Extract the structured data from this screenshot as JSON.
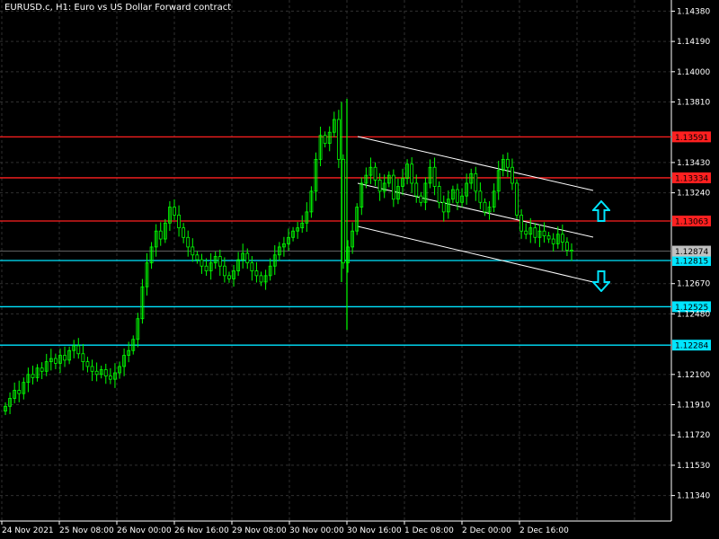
{
  "window": {
    "title": "EURUSD.c, H1:  Euro vs US Dollar Forward contract"
  },
  "price_axis": {
    "ticks": [
      "1.14380",
      "1.14190",
      "1.14000",
      "1.13810",
      "1.13430",
      "1.13240",
      "1.12670",
      "1.12480",
      "1.12100",
      "1.11910",
      "1.11720",
      "1.11530",
      "1.11340"
    ],
    "range": [
      1.1118,
      1.1445
    ]
  },
  "time_axis": {
    "labels": [
      "24 Nov 2021",
      "25 Nov 08:00",
      "26 Nov 00:00",
      "26 Nov 16:00",
      "29 Nov 08:00",
      "30 Nov 00:00",
      "30 Nov 16:00",
      "1 Dec 08:00",
      "2 Dec 00:00",
      "2 Dec 16:00"
    ]
  },
  "horizontal_lines": [
    {
      "price": 1.13591,
      "label": "1.13591",
      "color": "#ff2020",
      "label_bg": "#ff2020",
      "label_fg": "#000000"
    },
    {
      "price": 1.13334,
      "label": "1.13334",
      "color": "#ff2020",
      "label_bg": "#ff2020",
      "label_fg": "#000000"
    },
    {
      "price": 1.13063,
      "label": "1.13063",
      "color": "#ff2020",
      "label_bg": "#ff2020",
      "label_fg": "#000000"
    },
    {
      "price": 1.12815,
      "label": "1.12815",
      "color": "#00e5ff",
      "label_bg": "#00e5ff",
      "label_fg": "#000000"
    },
    {
      "price": 1.12525,
      "label": "1.12525",
      "color": "#00e5ff",
      "label_bg": "#00e5ff",
      "label_fg": "#000000"
    },
    {
      "price": 1.12284,
      "label": "1.12284",
      "color": "#00e5ff",
      "label_bg": "#00e5ff",
      "label_fg": "#000000"
    }
  ],
  "current_price": {
    "label": "1.12874",
    "bg": "#c0c0c0",
    "fg": "#000000"
  },
  "colors": {
    "candle": "#00ff00",
    "grid": "#303030",
    "channel": "#ffffff",
    "arrow": "#00e5ff"
  },
  "chart_data": {
    "type": "candlestick",
    "symbol": "EURUSD.c",
    "timeframe": "H1",
    "ylim": [
      1.1118,
      1.1445
    ],
    "xlabels": [
      "24 Nov 2021",
      "25 Nov 08:00",
      "26 Nov 00:00",
      "26 Nov 16:00",
      "29 Nov 08:00",
      "30 Nov 00:00",
      "30 Nov 16:00",
      "1 Dec 08:00",
      "2 Dec 00:00",
      "2 Dec 16:00"
    ],
    "close_path": [
      [
        1.119,
        1.1195,
        1.12,
        1.1198,
        1.1205,
        1.121,
        1.1208,
        1.1214,
        1.1212,
        1.1218,
        1.122,
        1.1217,
        1.1222,
        1.1219,
        1.1225,
        1.1228,
        1.1223,
        1.1218,
        1.1215,
        1.1212,
        1.121,
        1.1213,
        1.1209,
        1.1207,
        1.1211,
        1.1215,
        1.1222,
        1.1225,
        1.1232,
        1.1245,
        1.1265,
        1.128,
        1.129,
        1.13,
        1.1295,
        1.1305,
        1.1315,
        1.131,
        1.1302,
        1.1296,
        1.129,
        1.1285,
        1.1282,
        1.1278,
        1.1275,
        1.128,
        1.1284,
        1.1278,
        1.1272,
        1.127,
        1.1275,
        1.1282,
        1.1286,
        1.128,
        1.1275,
        1.1272,
        1.1268,
        1.1272,
        1.1278,
        1.1285,
        1.129,
        1.1292,
        1.1296,
        1.13,
        1.1302,
        1.1305,
        1.1312,
        1.1325,
        1.1345,
        1.136,
        1.1355,
        1.1362,
        1.137,
        1.1345,
        1.128,
        1.129,
        1.13,
        1.1315,
        1.133,
        1.1335,
        1.134,
        1.1332,
        1.1325,
        1.133,
        1.1335,
        1.132,
        1.1328,
        1.1333,
        1.1342,
        1.133,
        1.1322,
        1.1318,
        1.133,
        1.134,
        1.1328,
        1.1318,
        1.1312,
        1.132,
        1.1326,
        1.1318,
        1.1322,
        1.133,
        1.1336,
        1.1325,
        1.1318,
        1.1312,
        1.1315,
        1.1325,
        1.1338,
        1.1345,
        1.134,
        1.133,
        1.131,
        1.13,
        1.1298,
        1.1302,
        1.1296,
        1.13,
        1.1297,
        1.1295,
        1.1292,
        1.1298,
        1.1293,
        1.1288,
        1.12874
      ]
    ],
    "horizontal_levels": [
      1.13591,
      1.13334,
      1.13063,
      1.12815,
      1.12525,
      1.12284
    ],
    "channel_lines": "descending parallel channel (3 white lines) drawn from 30 Nov to 2 Dec",
    "annotations": [
      "up-arrow",
      "down-arrow"
    ]
  }
}
